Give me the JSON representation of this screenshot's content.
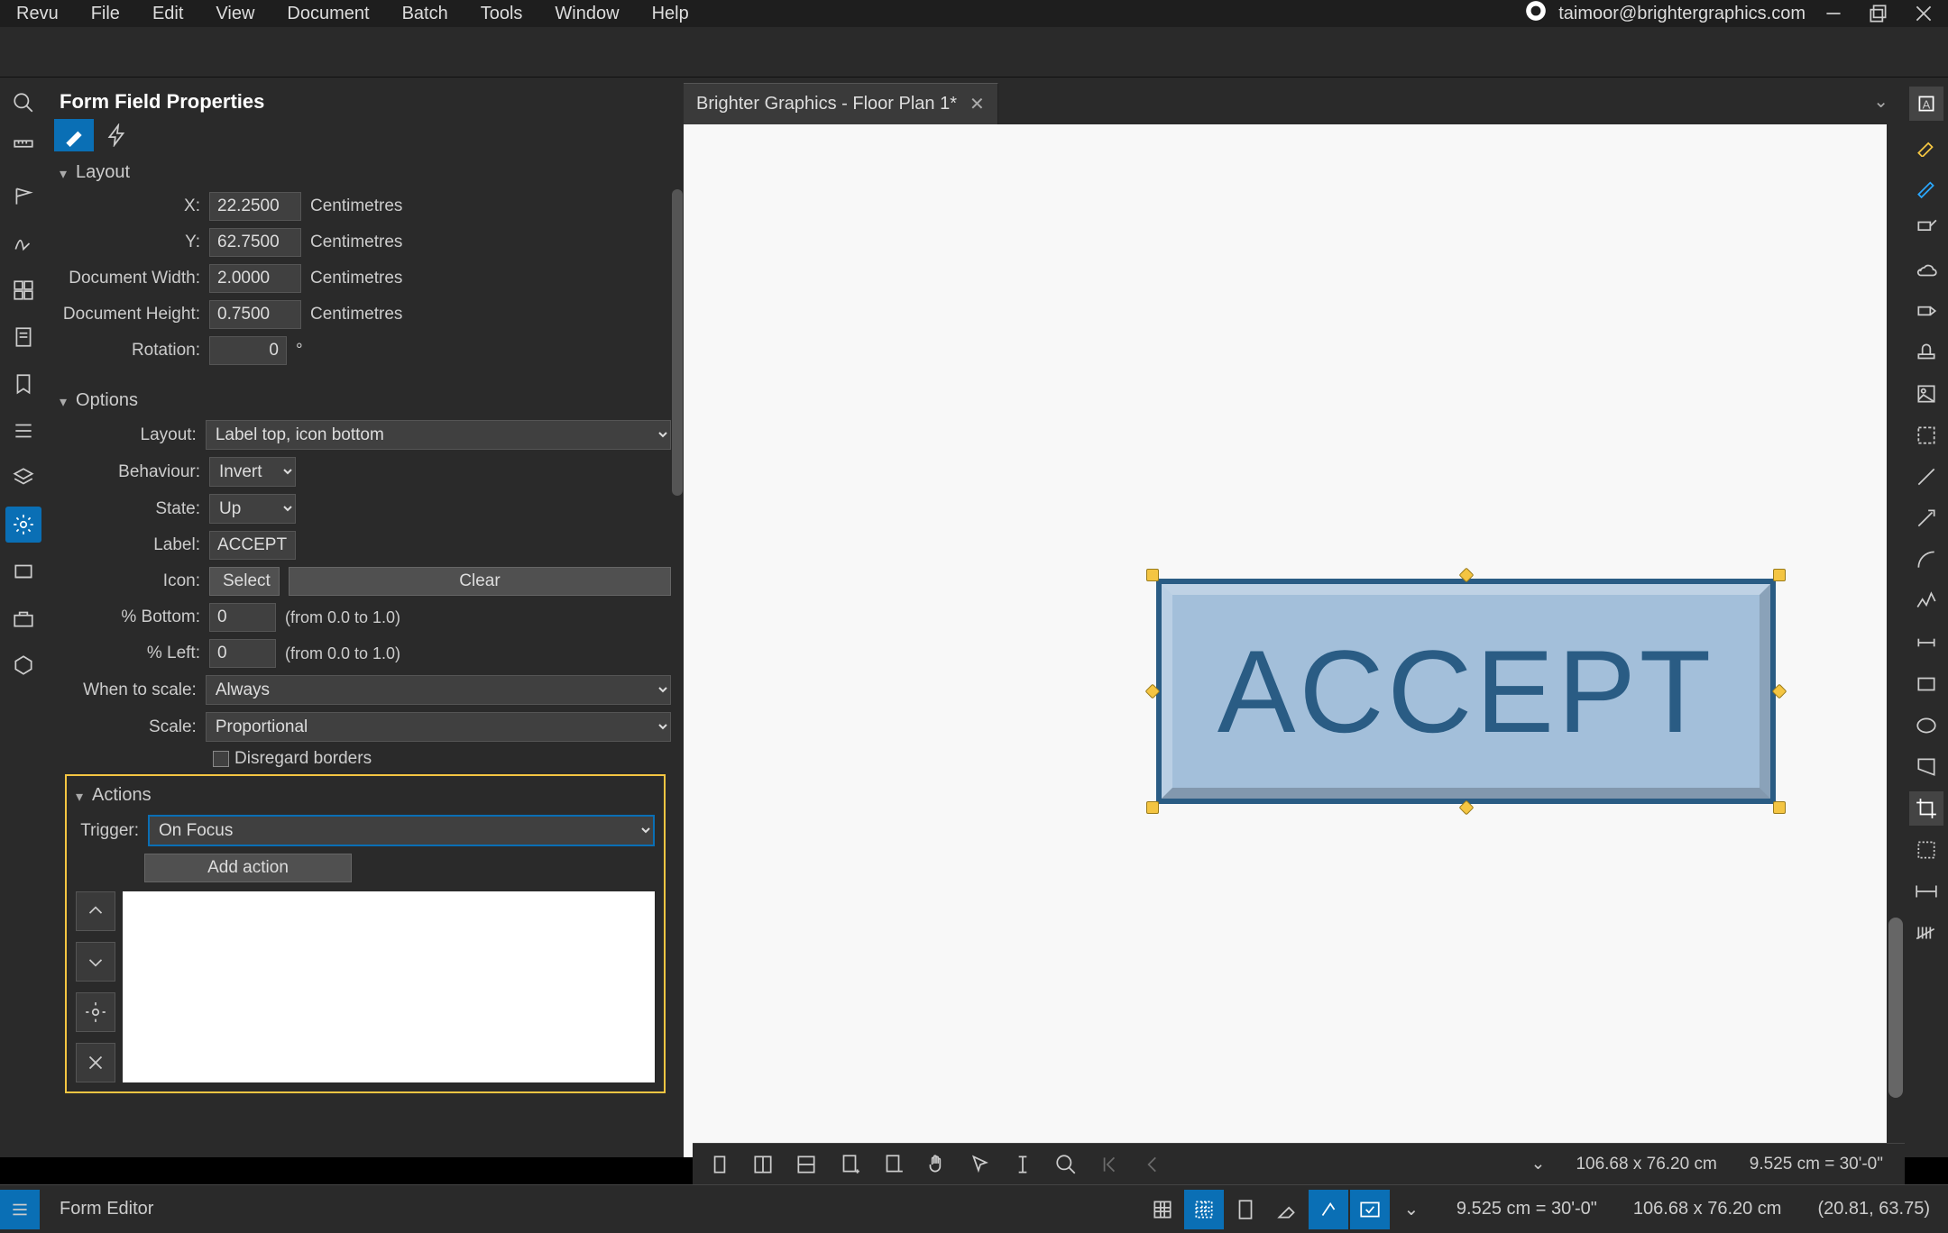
{
  "menu": {
    "items": [
      "Revu",
      "File",
      "Edit",
      "View",
      "Document",
      "Batch",
      "Tools",
      "Window",
      "Help"
    ]
  },
  "account": {
    "email": "taimoor@brightergraphics.com"
  },
  "tab": {
    "title": "Brighter Graphics - Floor Plan 1*"
  },
  "panel": {
    "title": "Form Field Properties",
    "layout": {
      "heading": "Layout",
      "x_label": "X:",
      "x_value": "22.2500",
      "unit_x": "Centimetres",
      "y_label": "Y:",
      "y_value": "62.7500",
      "unit_y": "Centimetres",
      "dw_label": "Document Width:",
      "dw_value": "2.0000",
      "unit_w": "Centimetres",
      "dh_label": "Document Height:",
      "dh_value": "0.7500",
      "unit_h": "Centimetres",
      "rot_label": "Rotation:",
      "rot_value": "0",
      "rot_unit": "°"
    },
    "options": {
      "heading": "Options",
      "layout_label": "Layout:",
      "layout_value": "Label top, icon bottom",
      "behaviour_label": "Behaviour:",
      "behaviour_value": "Invert",
      "state_label": "State:",
      "state_value": "Up",
      "label_label": "Label:",
      "label_value": "ACCEPT",
      "icon_label": "Icon:",
      "select_btn": "Select",
      "clear_btn": "Clear",
      "pbot_label": "% Bottom:",
      "pbot_value": "0",
      "range_hint1": "(from 0.0 to 1.0)",
      "pleft_label": "% Left:",
      "pleft_value": "0",
      "range_hint2": "(from 0.0 to 1.0)",
      "when_label": "When to scale:",
      "when_value": "Always",
      "scale_label": "Scale:",
      "scale_value": "Proportional",
      "disregard_label": "Disregard borders"
    },
    "actions": {
      "heading": "Actions",
      "trigger_label": "Trigger:",
      "trigger_value": "On Focus",
      "add_btn": "Add action"
    }
  },
  "accept_text": "ACCEPT",
  "doc_toolbar": {
    "dims_long": "106.68 x 76.20 cm",
    "dims_short": "9.525 cm = 30'-0\""
  },
  "status": {
    "mode": "Form Editor",
    "m1": "9.525 cm = 30'-0\"",
    "m2": "106.68 x 76.20 cm",
    "coords": "(20.81, 63.75)"
  }
}
